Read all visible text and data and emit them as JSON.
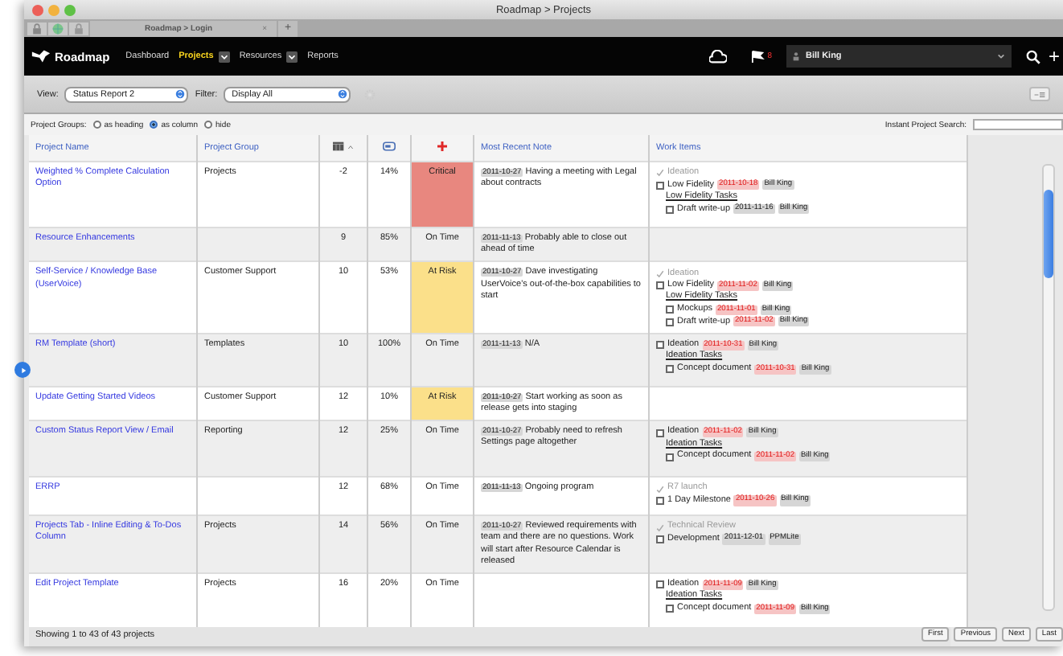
{
  "window": {
    "title": "Roadmap > Projects"
  },
  "browser_tab": {
    "label": "Roadmap > Login",
    "close": "×",
    "new_tab": "+"
  },
  "nav": {
    "logo": "Roadmap",
    "items": [
      {
        "label": "Dashboard",
        "selected": false,
        "dropdown": false
      },
      {
        "label": "Projects",
        "selected": true,
        "dropdown": true
      },
      {
        "label": "Resources",
        "selected": false,
        "dropdown": true
      },
      {
        "label": "Reports",
        "selected": false,
        "dropdown": false
      }
    ],
    "notifications": "8",
    "user": "Bill King",
    "add": "+"
  },
  "toolbar": {
    "view_label": "View:",
    "view": "Status Report 2",
    "filter_label": "Filter:",
    "filter": "Display All"
  },
  "project_groups": {
    "label": "Project Groups:",
    "options": [
      {
        "label": "as heading",
        "selected": false
      },
      {
        "label": "as column",
        "selected": true
      },
      {
        "label": "hide",
        "selected": false
      }
    ]
  },
  "search": {
    "label": "Instant Project Search:"
  },
  "table": {
    "columns": [
      {
        "kind": "text",
        "label": "Project Name"
      },
      {
        "kind": "text",
        "label": "Project Group"
      },
      {
        "kind": "calendar"
      },
      {
        "kind": "gauge"
      },
      {
        "kind": "cross"
      },
      {
        "kind": "text",
        "label": "Most Recent Note"
      },
      {
        "kind": "text",
        "label": "Work Items"
      }
    ],
    "rows": [
      {
        "name": "Weighted % Complete Calculation Option",
        "group": "Projects",
        "column_3": "-2",
        "column_4": "14%",
        "status": {
          "label": "Critical",
          "color": "#e8877f"
        },
        "note": {
          "date": "2011-10-27",
          "text": "Having a meeting with Legal about contracts"
        },
        "work_items": [
          {
            "kind": "task",
            "label": "Ideation",
            "checked": true
          },
          {
            "kind": "task",
            "label": "Low Fidelity",
            "checked": false,
            "date": "2011-10-18",
            "overdue": true,
            "owner": "Bill King"
          },
          {
            "kind": "group",
            "label": "Low Fidelity Tasks",
            "children": [
              {
                "kind": "task",
                "label": "Draft write-up",
                "checked": false,
                "date": "2011-11-16",
                "overdue": false,
                "owner": "Bill King"
              }
            ]
          }
        ]
      },
      {
        "name": "Resource Enhancements",
        "column_3": "9",
        "column_4": "85%",
        "status": {
          "label": "On Time"
        },
        "note": {
          "date": "2011-11-13",
          "text": "Probably able to close out ahead of time"
        }
      },
      {
        "name": "Self-Service / Knowledge Base (UserVoice)",
        "group": "Customer Support",
        "column_3": "10",
        "column_4": "53%",
        "status": {
          "label": "At Risk",
          "color": "#fbe08a"
        },
        "note": {
          "date": "2011-10-27",
          "text": "Dave investigating UserVoice's out-of-the-box capabilities to start"
        },
        "work_items": [
          {
            "kind": "task",
            "label": "Ideation",
            "checked": true
          },
          {
            "kind": "task",
            "label": "Low Fidelity",
            "checked": false,
            "date": "2011-11-02",
            "overdue": true,
            "owner": "Bill King"
          },
          {
            "kind": "group",
            "label": "Low Fidelity Tasks",
            "children": [
              {
                "kind": "task",
                "label": "Mockups",
                "checked": false,
                "date": "2011-11-01",
                "overdue": true,
                "owner": "Bill King"
              },
              {
                "kind": "task",
                "label": "Draft write-up",
                "checked": false,
                "date": "2011-11-02",
                "overdue": true,
                "owner": "Bill King"
              }
            ]
          }
        ]
      },
      {
        "name": "RM Template (short)",
        "group": "Templates",
        "column_3": "10",
        "column_4": "100%",
        "status": {
          "label": "On Time"
        },
        "note": {
          "date": "2011-11-13",
          "text": "N/A"
        },
        "work_items": [
          {
            "kind": "task",
            "label": "Ideation",
            "checked": false,
            "date": "2011-10-31",
            "overdue": true,
            "owner": "Bill King"
          },
          {
            "kind": "group",
            "label": "Ideation Tasks",
            "children": [
              {
                "kind": "task",
                "label": "Concept document",
                "checked": false,
                "date": "2011-10-31",
                "overdue": true,
                "owner": "Bill King"
              }
            ]
          }
        ]
      },
      {
        "name": "Update Getting Started Videos",
        "group": "Customer Support",
        "column_3": "12",
        "column_4": "10%",
        "status": {
          "label": "At Risk",
          "color": "#fbe08a"
        },
        "note": {
          "date": "2011-10-27",
          "text": "Start working as soon as release gets into staging"
        }
      },
      {
        "name": "Custom Status Report View / Email",
        "group": "Reporting",
        "column_3": "12",
        "column_4": "25%",
        "status": {
          "label": "On Time"
        },
        "note": {
          "date": "2011-10-27",
          "text": "Probably need to refresh Settings page altogether"
        },
        "work_items": [
          {
            "kind": "task",
            "label": "Ideation",
            "checked": false,
            "date": "2011-11-02",
            "overdue": true,
            "owner": "Bill King"
          },
          {
            "kind": "group",
            "label": "Ideation Tasks",
            "children": [
              {
                "kind": "task",
                "label": "Concept document",
                "checked": false,
                "date": "2011-11-02",
                "overdue": true,
                "owner": "Bill King"
              }
            ]
          }
        ]
      },
      {
        "name": "ERRP",
        "column_3": "12",
        "column_4": "68%",
        "status": {
          "label": "On Time"
        },
        "note": {
          "date": "2011-11-13",
          "text": "Ongoing program"
        },
        "work_items": [
          {
            "kind": "task",
            "label": "R7 launch",
            "checked": true
          },
          {
            "kind": "task",
            "label": "1 Day Milestone",
            "checked": false,
            "date": "2011-10-26",
            "overdue": true,
            "owner": "Bill King"
          }
        ]
      },
      {
        "name": "Projects Tab - Inline Editing & To-Dos Column",
        "group": "Projects",
        "column_3": "14",
        "column_4": "56%",
        "status": {
          "label": "On Time"
        },
        "note": {
          "date": "2011-10-27",
          "text": "Reviewed requirements with team and there are no questions. Work will start after Resource Calendar is released"
        },
        "work_items": [
          {
            "kind": "task",
            "label": "Technical Review",
            "checked": true
          },
          {
            "kind": "task",
            "label": "Development",
            "checked": false,
            "date": "2011-12-01",
            "overdue": false,
            "owner": "PPMLite"
          }
        ]
      },
      {
        "name": "Edit Project Template",
        "group": "Projects",
        "column_3": "16",
        "column_4": "20%",
        "status": {
          "label": "On Time"
        },
        "work_items": [
          {
            "kind": "task",
            "label": "Ideation",
            "checked": false,
            "date": "2011-11-09",
            "overdue": true,
            "owner": "Bill King"
          },
          {
            "kind": "group",
            "label": "Ideation Tasks",
            "children": [
              {
                "kind": "task",
                "label": "Concept document",
                "checked": false,
                "date": "2011-11-09",
                "overdue": true,
                "owner": "Bill King"
              }
            ]
          }
        ]
      }
    ]
  },
  "footer": {
    "summary": "Showing 1 to 43 of 43 projects",
    "pages": [
      "First",
      "Previous",
      "Next",
      "Last"
    ]
  }
}
